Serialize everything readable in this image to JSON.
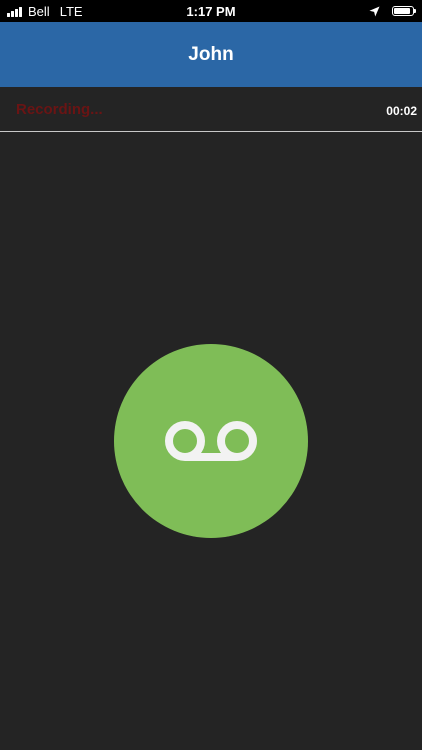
{
  "status_bar": {
    "carrier": "Bell",
    "network": "LTE",
    "time": "1:17 PM",
    "battery_level": 0.9
  },
  "header": {
    "title": "John"
  },
  "recording": {
    "status_text": "Recording...",
    "timer": "00:02"
  },
  "record_button": {
    "icon": "voicemail-icon"
  },
  "colors": {
    "header_bg": "#2b67a6",
    "background": "#242424",
    "recording_text": "#6a1414",
    "button_green": "#7fbd57",
    "icon_white": "#f2f2f2"
  }
}
